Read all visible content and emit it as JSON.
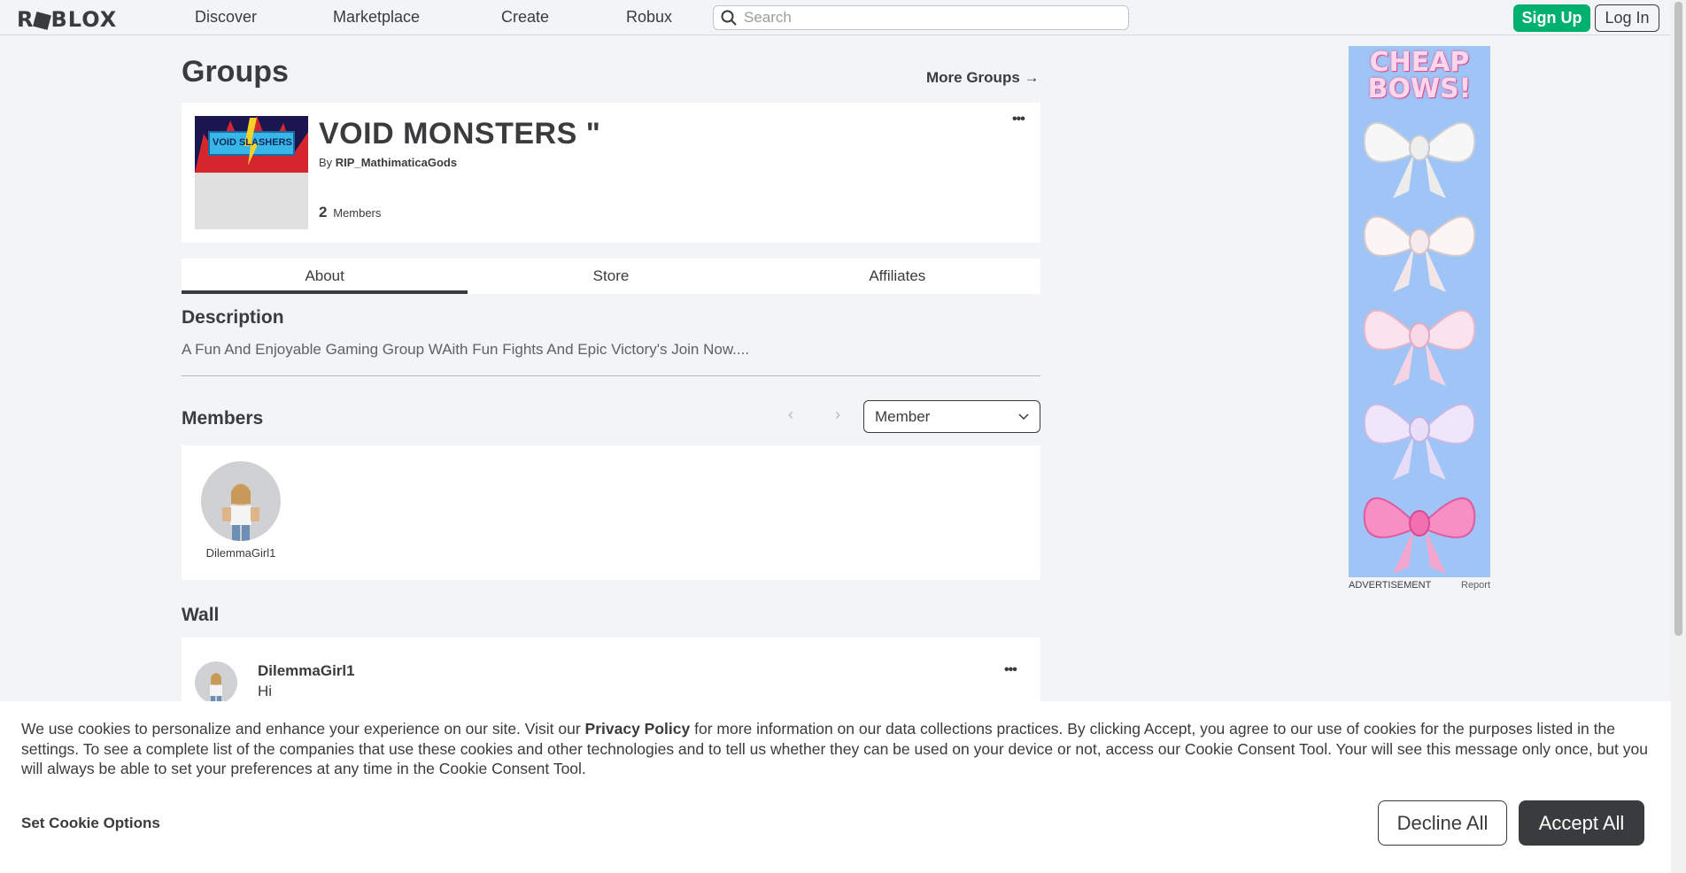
{
  "nav": {
    "logo": "R⬛BLOX",
    "links": [
      "Discover",
      "Marketplace",
      "Create",
      "Robux"
    ],
    "search_placeholder": "Search",
    "signup": "Sign Up",
    "login": "Log In"
  },
  "page": {
    "title": "Groups",
    "more_groups": "More Groups →"
  },
  "group": {
    "thumb_text": "VOID SLASHERS",
    "name": "VOID MONSTERS \"",
    "by_prefix": "By",
    "owner": "RIP_MathimaticaGods",
    "member_count": "2",
    "members_label": "Members",
    "menu": "•••"
  },
  "tabs": [
    "About",
    "Store",
    "Affiliates"
  ],
  "description": {
    "heading": "Description",
    "text": "A Fun And Enjoyable Gaming Group WAith Fun Fights And Epic Victory's Join Now...."
  },
  "members": {
    "heading": "Members",
    "prev": "‹",
    "next": "›",
    "role_selected": "Member",
    "list": [
      {
        "name": "DilemmaGirl1"
      }
    ]
  },
  "wall": {
    "heading": "Wall",
    "posts": [
      {
        "user": "DilemmaGirl1",
        "message": "Hi",
        "menu": "•••"
      }
    ]
  },
  "ad": {
    "headline_line1": "CHEAP",
    "headline_line2": "BOWS!",
    "label": "ADVERTISEMENT",
    "report": "Report"
  },
  "cookie": {
    "text_before_link": "We use cookies to personalize and enhance your experience on our site. Visit our ",
    "link": "Privacy Policy",
    "text_after_link": " for more information on our data collections practices. By clicking Accept, you agree to our use of cookies for the purposes listed in the settings. To see a complete list of the companies that use these cookies and other technologies and to tell us whether they can be used on your device or not, access our Cookie Consent Tool. Your will see this message only once, but you will always be able to set your preferences at any time in the Cookie Consent Tool.",
    "options": "Set Cookie Options",
    "decline": "Decline All",
    "accept": "Accept All"
  },
  "colors": {
    "signup_green": "#00b06f",
    "dark": "#393b3d",
    "ad_bg": "#9ec5f5"
  }
}
